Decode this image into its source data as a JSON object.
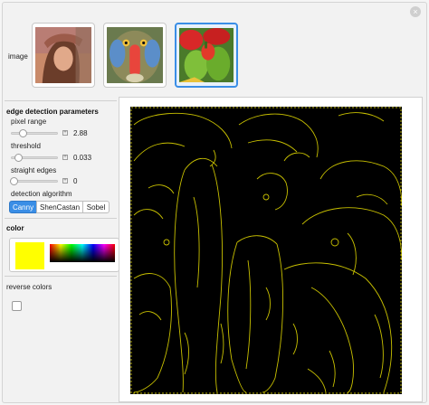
{
  "controls": {
    "image_label": "image",
    "images": [
      "lena",
      "mandrill",
      "peppers"
    ],
    "selected_image": "peppers",
    "section_edge": "edge detection parameters",
    "pixel_range": {
      "label": "pixel range",
      "value": "2.88",
      "fraction": 0.3
    },
    "threshold": {
      "label": "threshold",
      "value": "0.033",
      "fraction": 0.12
    },
    "straight_edges": {
      "label": "straight edges",
      "value": "0",
      "fraction": 0.0
    },
    "detection_algorithm": {
      "label": "detection algorithm",
      "options": [
        "Canny",
        "ShenCastan",
        "Sobel"
      ],
      "selected": "Canny"
    },
    "color_label": "color",
    "color_value": "#ffff00",
    "reverse_label": "reverse colors",
    "reverse_checked": false
  },
  "icons": {
    "close": "close-icon",
    "slider_expand": "plus-icon"
  },
  "colors": {
    "accent": "#3a8ee6",
    "edge": "#ffff00",
    "background": "#000000"
  }
}
